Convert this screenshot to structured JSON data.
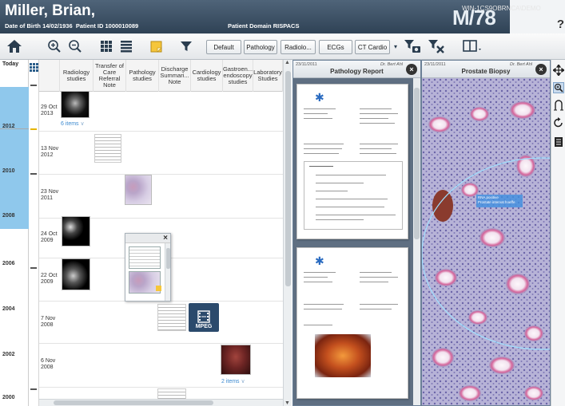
{
  "header": {
    "patient_name": "Miller, Brian,",
    "dob_label": "Date of Birth",
    "dob": "14/02/1936",
    "pid_label": "Patient ID",
    "pid": "1000010089",
    "domain_label": "Patient Domain",
    "domain": "RISPACS",
    "age_sex": "M/78",
    "workstation": "WIN-1CS9OBRNCA\\DEMO",
    "help": "?"
  },
  "toolbar": {
    "filters": [
      "Default",
      "Pathology",
      "Radiolo...",
      "ECGs",
      "CT Cardio"
    ],
    "dropdown_arrow": "▾"
  },
  "timeline": {
    "today": "Today",
    "years": [
      "2012",
      "2010",
      "2008",
      "2006",
      "2004",
      "2002",
      "2000"
    ]
  },
  "columns": [
    "Radiology studies",
    "Transfer of Care Referral Note",
    "Pathology studies",
    "Discharge Summari... Note",
    "Cardiology studies",
    "Gastroen... endoscopy studies",
    "Laboratory Studies"
  ],
  "rows": [
    {
      "day": "29 Oct",
      "year": "2013"
    },
    {
      "day": "13 Nov",
      "year": "2012"
    },
    {
      "day": "23 Nov",
      "year": "2011"
    },
    {
      "day": "24 Oct",
      "year": "2009"
    },
    {
      "day": "22 Oct",
      "year": "2009"
    },
    {
      "day": "7 Nov",
      "year": "2008"
    },
    {
      "day": "6 Nov",
      "year": "2008"
    }
  ],
  "items": {
    "radiology_2013": "6 items",
    "gastro_2008": "2 items",
    "mpeg": "MPEG"
  },
  "viewers": {
    "pathology": {
      "date": "23/11/2011",
      "doctor": "Dr. Bert Ahl",
      "title": "Pathology Report"
    },
    "biopsy": {
      "date": "23/11/2011",
      "doctor": "Dr. Bert Ahl",
      "title": "Prostate Biopsy",
      "annotation": "RNA positive\nProstate intervat hoeffe"
    }
  },
  "icons": {
    "home": "home-icon",
    "zoom_in": "zoom-in-icon",
    "zoom_out": "zoom-out-icon",
    "grid": "grid-view-icon",
    "list": "list-view-icon",
    "note": "sticky-note-icon",
    "filter": "filter-icon",
    "filter_camera": "filter-camera-icon",
    "filter_clear": "filter-clear-icon",
    "layout": "layout-icon"
  }
}
